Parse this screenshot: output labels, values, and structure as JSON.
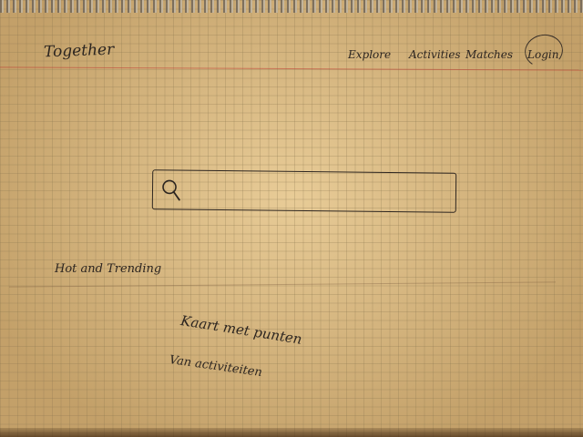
{
  "header": {
    "brand": "Together",
    "nav": [
      {
        "label": "Explore"
      },
      {
        "label": "Activities"
      },
      {
        "label": "Matches"
      },
      {
        "label": "Login"
      }
    ]
  },
  "search": {
    "icon": "search-icon",
    "placeholder": ""
  },
  "sections": {
    "hot": "Hot and Trending",
    "map_title": "Kaart met punten",
    "map_subtitle": "Van activiteiten"
  }
}
